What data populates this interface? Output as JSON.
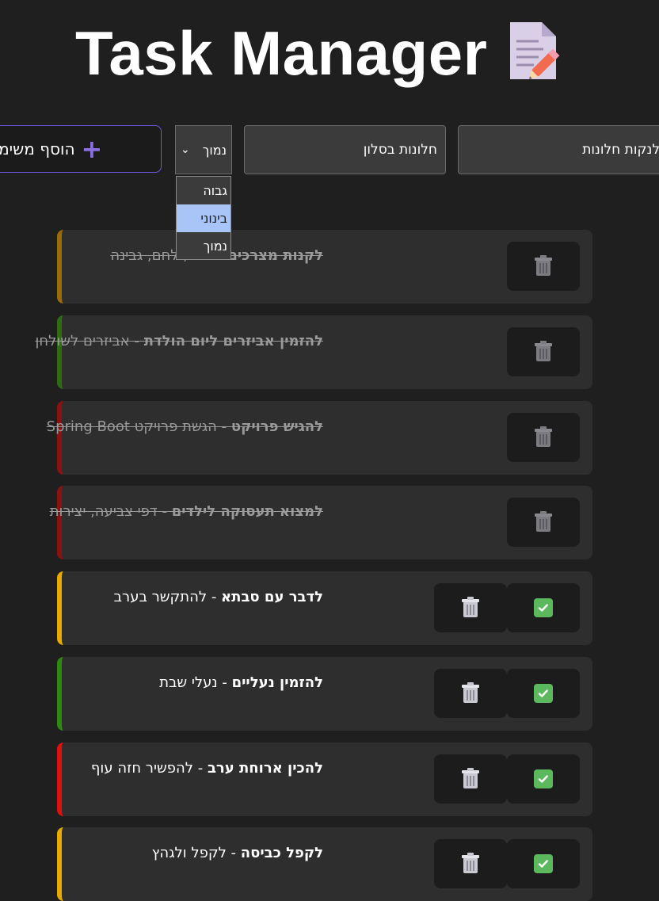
{
  "app": {
    "title": "Task Manager",
    "title_icon": "memo-icon"
  },
  "form": {
    "title_value": "לנקות חלונות",
    "description_value": "חלונות בסלון",
    "priority_selected": "נמוך",
    "priority_options": [
      "גבוה",
      "בינוני",
      "נמוך"
    ],
    "priority_highlighted": "בינוני",
    "add_label": "הוסף משימה",
    "add_icon": "plus-icon"
  },
  "tasks": [
    {
      "title": "לקנות מצרכים",
      "description": "חלב, לחם, גבינה",
      "priority_color": "#9a6b0a",
      "completed": true
    },
    {
      "title": "להזמין אביזרים ליום הולדת",
      "description": "אביזרים לשולחן",
      "priority_color": "#2e6b12",
      "completed": true
    },
    {
      "title": "להגיש פרויקט",
      "description": "הגשת פרויקט Spring Boot",
      "priority_color": "#8c1111",
      "completed": true
    },
    {
      "title": "למצוא תעסוקה לילדים",
      "description": "דפי צביעה, יצירות",
      "priority_color": "#8c1111",
      "completed": true
    },
    {
      "title": "לדבר עם סבתא",
      "description": "להתקשר בערב",
      "priority_color": "#e8a900",
      "completed": false
    },
    {
      "title": "להזמין נעליים",
      "description": "נעלי שבת",
      "priority_color": "#2e8a0f",
      "completed": false
    },
    {
      "title": "להכין ארוחת ערב",
      "description": "להפשיר חזה עוף",
      "priority_color": "#e01010",
      "completed": false
    },
    {
      "title": "לקפל כביסה",
      "description": "לקפל ולגהץ",
      "priority_color": "#e8a900",
      "completed": false
    }
  ],
  "icons": {
    "delete": "trash-icon",
    "complete": "check-icon"
  }
}
